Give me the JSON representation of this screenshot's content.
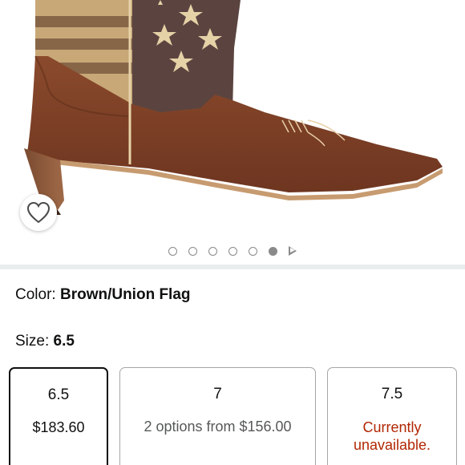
{
  "product": {
    "image_alt": "Brown western boot with union flag shaft",
    "wishlist_icon": "heart-outline-icon"
  },
  "carousel": {
    "dot_count": 6,
    "active_index": 5,
    "next_icon": "play-triangle-icon"
  },
  "color": {
    "label": "Color:",
    "value": "Brown/Union Flag"
  },
  "size": {
    "label": "Size:",
    "value": "6.5"
  },
  "size_options": [
    {
      "size": "6.5",
      "price": "$183.60",
      "state": "selected"
    },
    {
      "size": "7",
      "price": "2 options from $156.00",
      "state": "available"
    },
    {
      "size": "7.5",
      "price": "Currently unavailable.",
      "state": "unavailable"
    }
  ],
  "colors": {
    "text": "#0f1111",
    "muted": "#565959",
    "unavailable": "#b12704",
    "divider": "#e9eded",
    "dot": "#8a8a8a"
  }
}
